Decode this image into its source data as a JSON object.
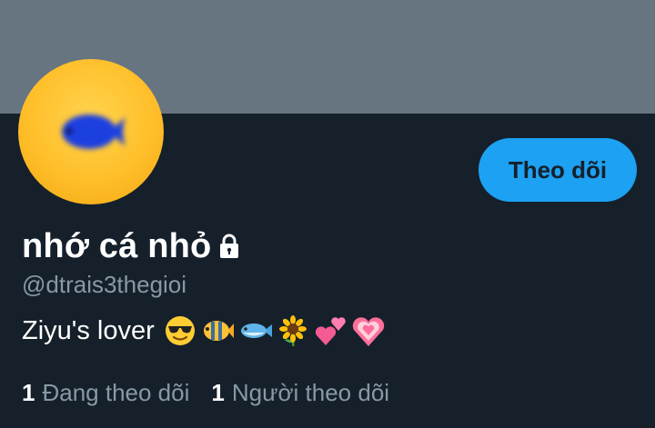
{
  "profile": {
    "display_name": "nhớ cá nhỏ",
    "handle": "@dtrais3thegioi",
    "bio_text": "Ziyu's lover",
    "bio_emojis": [
      "smiling-face-with-sunglasses",
      "tropical-fish",
      "fish",
      "sunflower",
      "two-hearts",
      "growing-heart"
    ],
    "protected_icon": "lock-icon"
  },
  "actions": {
    "follow_label": "Theo dõi"
  },
  "stats": {
    "following_count": "1",
    "following_label": "Đang theo dõi",
    "followers_count": "1",
    "followers_label": "Người theo dõi"
  },
  "colors": {
    "background": "#15202b",
    "banner": "#66757f",
    "accent": "#1da1f2",
    "secondary_text": "#8899a6"
  }
}
